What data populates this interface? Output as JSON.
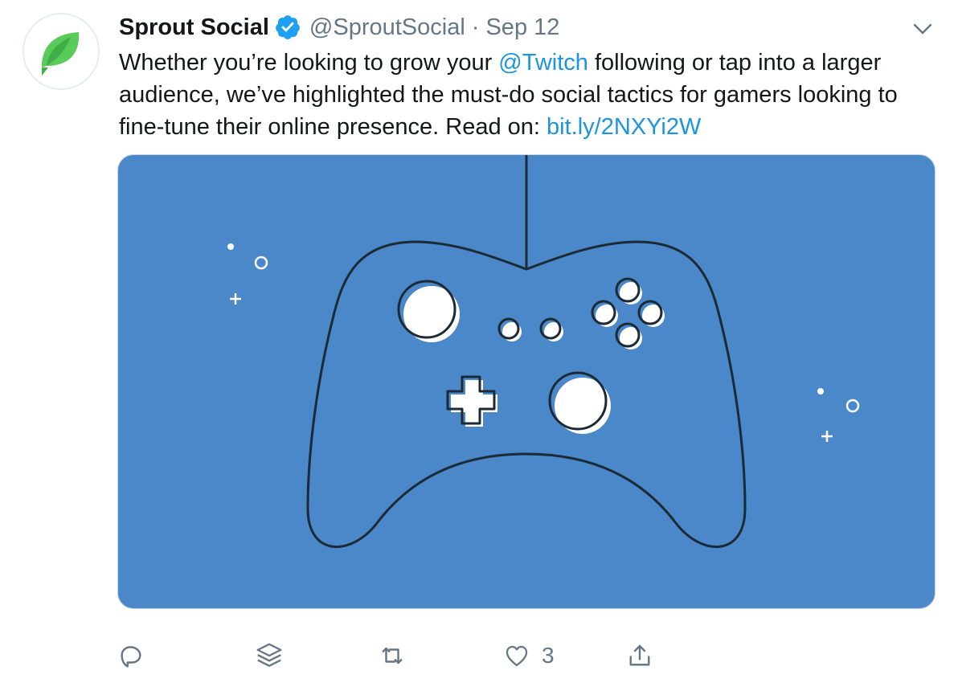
{
  "tweet": {
    "display_name": "Sprout Social",
    "handle": "@SproutSocial",
    "separator": "·",
    "date": "Sep 12",
    "text_part1": "Whether you’re looking to grow your ",
    "mention": "@Twitch",
    "text_part2": " following or tap into a larger audience, we’ve highlighted the must-do social tactics for gamers looking to fine-tune their online presence. Read on: ",
    "link": "bit.ly/2NXYi2W",
    "verified_icon": "verified-badge-icon",
    "avatar_icon": "sprout-leaf-logo"
  },
  "actions": {
    "reply_icon": "reply-icon",
    "layers_icon": "layers-icon",
    "retweet_icon": "retweet-icon",
    "like_icon": "heart-icon",
    "like_count": "3",
    "share_icon": "share-icon"
  },
  "colors": {
    "link": "#1b95e0",
    "verified": "#1da1f2",
    "media_background": "#4a88c9",
    "brand_green": "#59cb59",
    "secondary_text": "#657786"
  }
}
